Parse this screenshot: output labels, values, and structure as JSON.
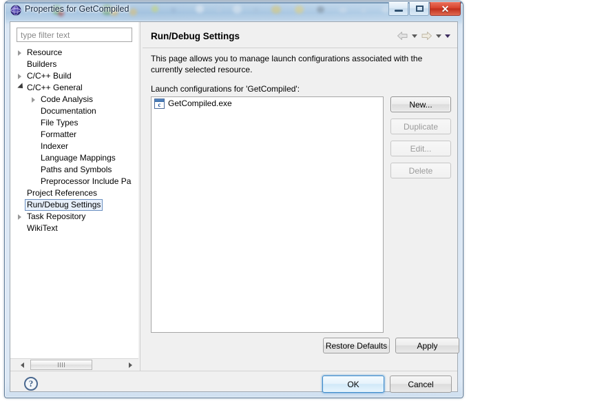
{
  "window": {
    "title": "Properties for GetCompiled",
    "app_icon": "eclipse-globe-icon",
    "controls": {
      "minimize_label": "Minimize",
      "maximize_label": "Maximize",
      "close_label": "✕"
    }
  },
  "sidebar": {
    "filter": {
      "placeholder": "type filter text",
      "value": ""
    },
    "items": [
      {
        "label": "Resource",
        "indent": 0,
        "twisty": "collapsed",
        "selected": false
      },
      {
        "label": "Builders",
        "indent": 0,
        "twisty": "none",
        "selected": false
      },
      {
        "label": "C/C++ Build",
        "indent": 0,
        "twisty": "collapsed",
        "selected": false
      },
      {
        "label": "C/C++ General",
        "indent": 0,
        "twisty": "expanded",
        "selected": false
      },
      {
        "label": "Code Analysis",
        "indent": 1,
        "twisty": "collapsed",
        "selected": false
      },
      {
        "label": "Documentation",
        "indent": 1,
        "twisty": "none",
        "selected": false
      },
      {
        "label": "File Types",
        "indent": 1,
        "twisty": "none",
        "selected": false
      },
      {
        "label": "Formatter",
        "indent": 1,
        "twisty": "none",
        "selected": false
      },
      {
        "label": "Indexer",
        "indent": 1,
        "twisty": "none",
        "selected": false
      },
      {
        "label": "Language Mappings",
        "indent": 1,
        "twisty": "none",
        "selected": false
      },
      {
        "label": "Paths and Symbols",
        "indent": 1,
        "twisty": "none",
        "selected": false
      },
      {
        "label": "Preprocessor Include Pa",
        "indent": 1,
        "twisty": "none",
        "selected": false
      },
      {
        "label": "Project References",
        "indent": 0,
        "twisty": "none",
        "selected": false
      },
      {
        "label": "Run/Debug Settings",
        "indent": 0,
        "twisty": "none",
        "selected": true
      },
      {
        "label": "Task Repository",
        "indent": 0,
        "twisty": "collapsed",
        "selected": false
      },
      {
        "label": "WikiText",
        "indent": 0,
        "twisty": "none",
        "selected": false
      }
    ],
    "scrollbar": {
      "left_arrow": "◀",
      "right_arrow": "▶"
    }
  },
  "page": {
    "title": "Run/Debug Settings",
    "nav": {
      "back": "back-arrow",
      "back_menu": "back-dropdown",
      "forward": "forward-arrow",
      "forward_menu": "forward-dropdown",
      "view_menu": "view-menu"
    },
    "description": "This page allows you to manage launch configurations associated with the currently selected resource.",
    "list_label": "Launch configurations for 'GetCompiled':",
    "configurations": [
      {
        "name": "GetCompiled.exe",
        "icon": "c-launch-config-icon"
      }
    ],
    "side_buttons": [
      {
        "label": "New...",
        "enabled": true
      },
      {
        "label": "Duplicate",
        "enabled": false
      },
      {
        "label": "Edit...",
        "enabled": false
      },
      {
        "label": "Delete",
        "enabled": false
      }
    ],
    "restore_defaults_label": "Restore Defaults",
    "apply_label": "Apply"
  },
  "footer": {
    "help_glyph": "?",
    "ok_label": "OK",
    "cancel_label": "Cancel"
  },
  "colors": {
    "accent": "#3c8bcc",
    "title_text": "#10253f",
    "dialog_bg": "#f0f0f0",
    "selection_border": "#6a8fc0",
    "close_button": "#d9452f"
  }
}
